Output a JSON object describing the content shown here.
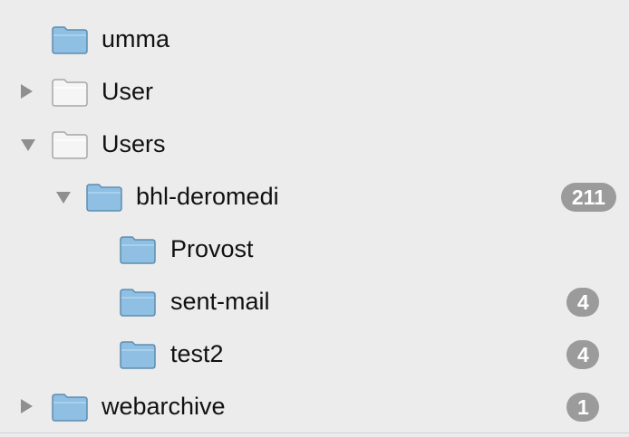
{
  "folders": [
    {
      "label": "umma",
      "state": "none",
      "badge": null,
      "folder_style": "blue"
    },
    {
      "label": "User",
      "state": "collapsed",
      "badge": null,
      "folder_style": "white"
    },
    {
      "label": "Users",
      "state": "expanded",
      "badge": null,
      "folder_style": "white"
    },
    {
      "label": "bhl-deromedi",
      "state": "expanded",
      "badge": "211",
      "folder_style": "blue"
    },
    {
      "label": "Provost",
      "state": "none",
      "badge": null,
      "folder_style": "blue"
    },
    {
      "label": "sent-mail",
      "state": "none",
      "badge": "4",
      "folder_style": "blue"
    },
    {
      "label": "test2",
      "state": "none",
      "badge": "4",
      "folder_style": "blue"
    },
    {
      "label": "webarchive",
      "state": "collapsed",
      "badge": "1",
      "folder_style": "blue"
    }
  ],
  "colors": {
    "background": "#ececec",
    "badge": "#9b9b9b",
    "folder_blue": "#8fc0e3",
    "folder_white": "#f5f5f5"
  },
  "icons": {
    "folder": "folder-icon",
    "expanded": "disclosure-expanded-icon",
    "collapsed": "disclosure-collapsed-icon"
  }
}
